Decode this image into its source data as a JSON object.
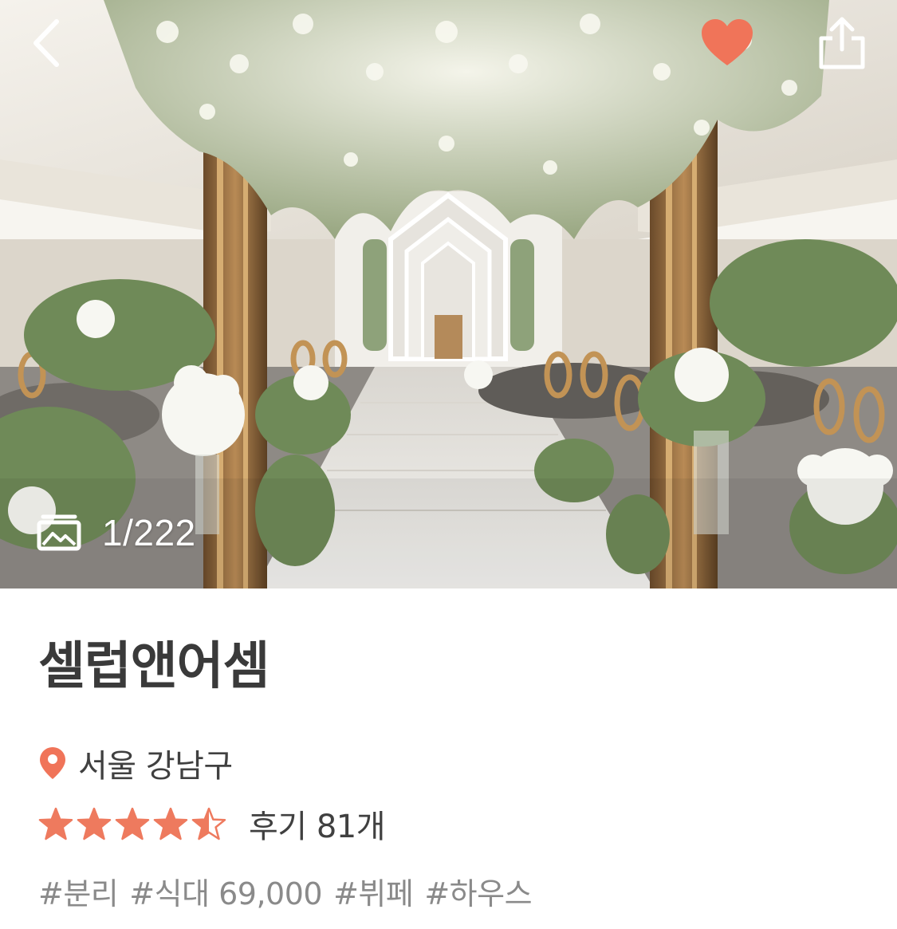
{
  "nav": {
    "back_icon": "chevron-left-icon",
    "favorite_icon": "heart-icon",
    "favorite_active": true,
    "share_icon": "share-icon"
  },
  "gallery": {
    "icon": "gallery-icon",
    "counter": "1/222"
  },
  "venue": {
    "name": "셀럽앤어셈",
    "location_icon": "location-pin-icon",
    "location": "서울 강남구",
    "rating": 4.5,
    "rating_max": 5,
    "reviews": "후기 81개",
    "tags": [
      "#분리",
      "#식대 69,000",
      "#뷔페",
      "#하우스"
    ]
  },
  "colors": {
    "accent": "#f07459",
    "star": "#ee7a5e",
    "title": "#3a3a3a",
    "body": "#404040",
    "tag": "#8a8a8a"
  }
}
